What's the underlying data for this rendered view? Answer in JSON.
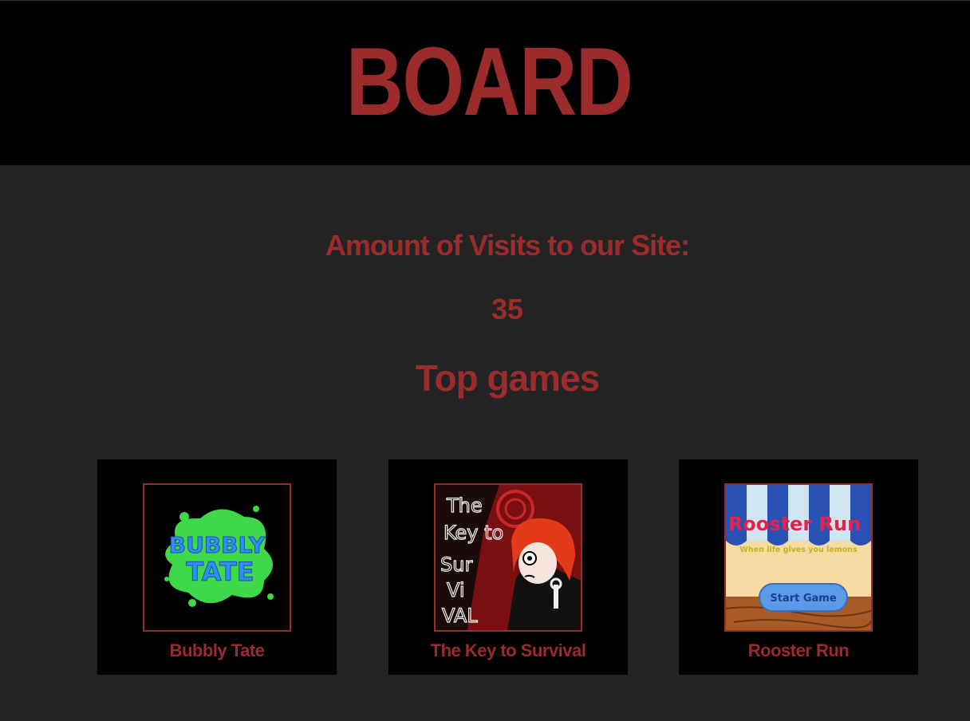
{
  "site": {
    "title": "BOARD"
  },
  "stats": {
    "visits_label": "Amount of Visits to our Site:",
    "visits_count": "35"
  },
  "section": {
    "title": "Top games"
  },
  "games": [
    {
      "title": "Bubbly Tate",
      "thumb_text_1": "BUBBLY",
      "thumb_text_2": "TATE"
    },
    {
      "title": "The Key to Survival",
      "thumb_lines": [
        "The",
        "Key to",
        "Sur",
        "Vi",
        "VAL"
      ]
    },
    {
      "title": "Rooster Run",
      "thumb_title": "Rooster Run",
      "thumb_tagline": "When life gives you lemons",
      "thumb_button": "Start Game"
    }
  ],
  "colors": {
    "accent": "#9c2b2b",
    "header_bg": "#000000",
    "page_bg": "#232323",
    "card_bg": "#000000"
  }
}
